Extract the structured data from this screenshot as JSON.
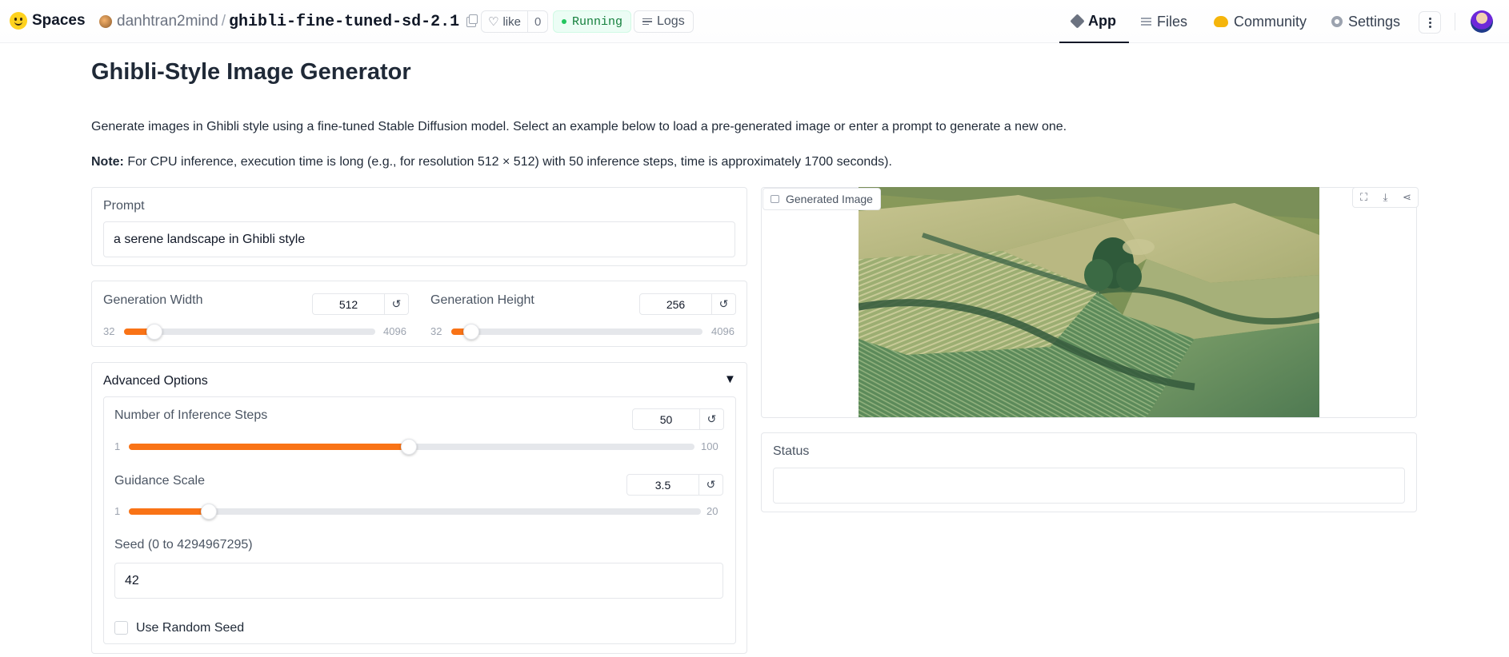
{
  "topbar": {
    "brand": "Spaces",
    "owner": "danhtran2mind",
    "slash": "/",
    "repo_name": "ghibli-fine-tuned-sd-2.1",
    "like_label": "like",
    "like_count": "0",
    "status": "Running",
    "logs_label": "Logs",
    "nav": {
      "app": "App",
      "files": "Files",
      "community": "Community",
      "settings": "Settings"
    }
  },
  "page": {
    "title": "Ghibli-Style Image Generator",
    "description": "Generate images in Ghibli style using a fine-tuned Stable Diffusion model. Select an example below to load a pre-generated image or enter a prompt to generate a new one.",
    "note_label": "Note:",
    "note_text": " For CPU inference, execution time is long (e.g., for resolution 512 × 512) with 50 inference steps, time is approximately 1700 seconds)."
  },
  "prompt": {
    "label": "Prompt",
    "value": "a serene landscape in Ghibli style"
  },
  "width": {
    "label": "Generation Width",
    "value": "512",
    "min": "32",
    "max": "4096",
    "fraction": 0.12
  },
  "height": {
    "label": "Generation Height",
    "value": "256",
    "min": "32",
    "max": "4096",
    "fraction": 0.08
  },
  "advanced": {
    "label": "Advanced Options",
    "toggle": "▼",
    "steps": {
      "label": "Number of Inference Steps",
      "value": "50",
      "min": "1",
      "max": "100",
      "fraction": 0.495
    },
    "guidance": {
      "label": "Guidance Scale",
      "value": "3.5",
      "min": "1",
      "max": "20",
      "fraction": 0.14
    },
    "seed": {
      "label": "Seed (0 to 4294967295)",
      "value": "42"
    },
    "random_seed": {
      "label": "Use Random Seed",
      "checked": false
    }
  },
  "output": {
    "image_label": "Generated Image",
    "status_label": "Status",
    "status_value": ""
  },
  "reset_glyph": "↺",
  "colors": {
    "accent": "#f97316",
    "running": "#15803d"
  }
}
